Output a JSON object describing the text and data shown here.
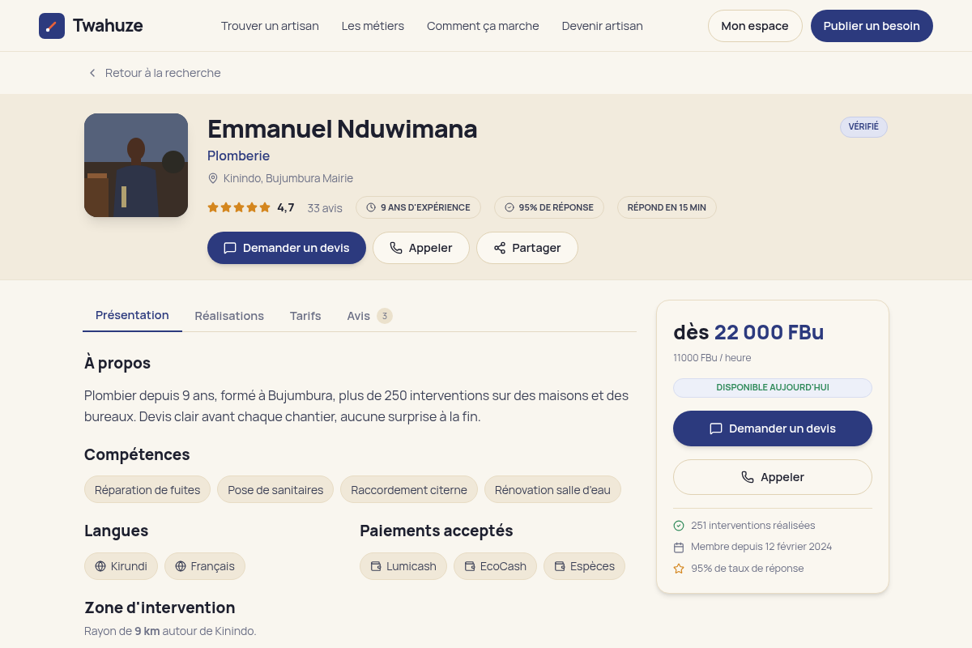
{
  "nav": {
    "brand": "Twahuze",
    "links": [
      "Trouver un artisan",
      "Les métiers",
      "Comment ça marche",
      "Devenir artisan"
    ],
    "buttons": [
      {
        "label": "Mon espace",
        "kind": "outline"
      },
      {
        "label": "Publier un besoin",
        "kind": "primary"
      }
    ]
  },
  "back_link": "Retour à la recherche",
  "profile": {
    "name": "Emmanuel Nduwimana",
    "trade": "Plomberie",
    "location": "Kinindo, Bujumbura Mairie",
    "stars": 5,
    "rating": "4,7",
    "reviews": "33 avis",
    "chips": [
      {
        "kind": "clock",
        "label": "9 ANS D'EXPÉRIENCE"
      },
      {
        "kind": "check",
        "label": "95% DE RÉPONSE"
      },
      {
        "kind": "plain",
        "label": "RÉPOND EN 15 MIN"
      }
    ],
    "badge": "VÉRIFIÉ",
    "actions": [
      {
        "kind": "message",
        "primary": true,
        "label": "Demander un devis"
      },
      {
        "kind": "phone",
        "primary": false,
        "label": "Appeler"
      },
      {
        "kind": "share",
        "primary": false,
        "label": "Partager"
      }
    ]
  },
  "tabs": [
    {
      "label": "Présentation",
      "selected": true
    },
    {
      "label": "Réalisations",
      "selected": false
    },
    {
      "label": "Tarifs",
      "selected": false
    },
    {
      "label": "Avis",
      "selected": false,
      "count": "3"
    }
  ],
  "about": {
    "title": "À propos",
    "text": "Plombier depuis 9 ans, formé à Bujumbura, plus de 250 interventions sur des maisons et des bureaux. Devis clair avant chaque chantier, aucune surprise à la fin."
  },
  "skills": {
    "title": "Compétences",
    "items": [
      "Réparation de fuites",
      "Pose de sanitaires",
      "Raccordement citerne",
      "Rénovation salle d'eau"
    ]
  },
  "languages": {
    "title": "Langues",
    "items": [
      "Kirundi",
      "Français"
    ]
  },
  "payments": {
    "title": "Paiements acceptés",
    "items": [
      "Lumicash",
      "EcoCash",
      "Espèces"
    ]
  },
  "zone": {
    "title": "Zone d'intervention",
    "text": "Rayon de **9 km** autour de Kinindo."
  },
  "price_card": {
    "prefix": "dès",
    "price": "22 000 FBu",
    "rate": "11000 FBu / heure",
    "availability": "DISPONIBLE AUJOURD'HUI",
    "actions": [
      {
        "kind": "message",
        "primary": true,
        "label": "Demander un devis"
      },
      {
        "kind": "phone",
        "primary": false,
        "label": "Appeler"
      }
    ],
    "facts": [
      {
        "kind": "check",
        "text": "251 interventions réalisées"
      },
      {
        "kind": "calendar",
        "text": "Membre depuis 12 février 2024"
      },
      {
        "kind": "star",
        "text": "95% de taux de réponse"
      }
    ]
  }
}
